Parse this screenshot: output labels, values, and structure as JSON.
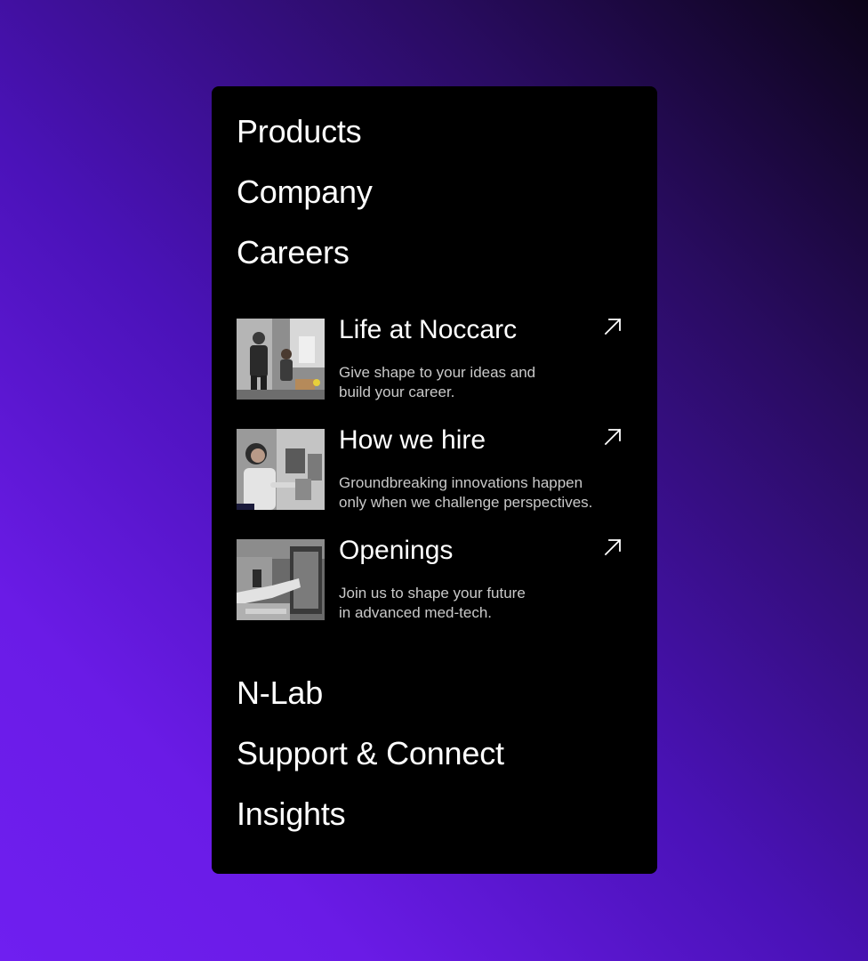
{
  "menu": {
    "primary_top": [
      {
        "label": "Products"
      },
      {
        "label": "Company"
      },
      {
        "label": "Careers"
      }
    ],
    "careers_submenu": [
      {
        "title": "Life at Noccarc",
        "description_line1": "Give shape to your ideas and",
        "description_line2": "build your career.",
        "icon": "arrow-up-right-icon"
      },
      {
        "title": "How we hire",
        "description_line1": "Groundbreaking innovations happen",
        "description_line2": "only when we challenge perspectives.",
        "icon": "arrow-up-right-icon"
      },
      {
        "title": "Openings",
        "description_line1": "Join us to shape your future",
        "description_line2": "in advanced med-tech.",
        "icon": "arrow-up-right-icon"
      }
    ],
    "primary_bottom": [
      {
        "label": "N-Lab"
      },
      {
        "label": "Support & Connect"
      },
      {
        "label": "Insights"
      }
    ]
  },
  "colors": {
    "card_background": "#000000",
    "text_primary": "#ffffff",
    "text_secondary": "#c9c9c9",
    "background_gradient_start": "#6f1ff0",
    "background_gradient_end": "#0c0418"
  }
}
